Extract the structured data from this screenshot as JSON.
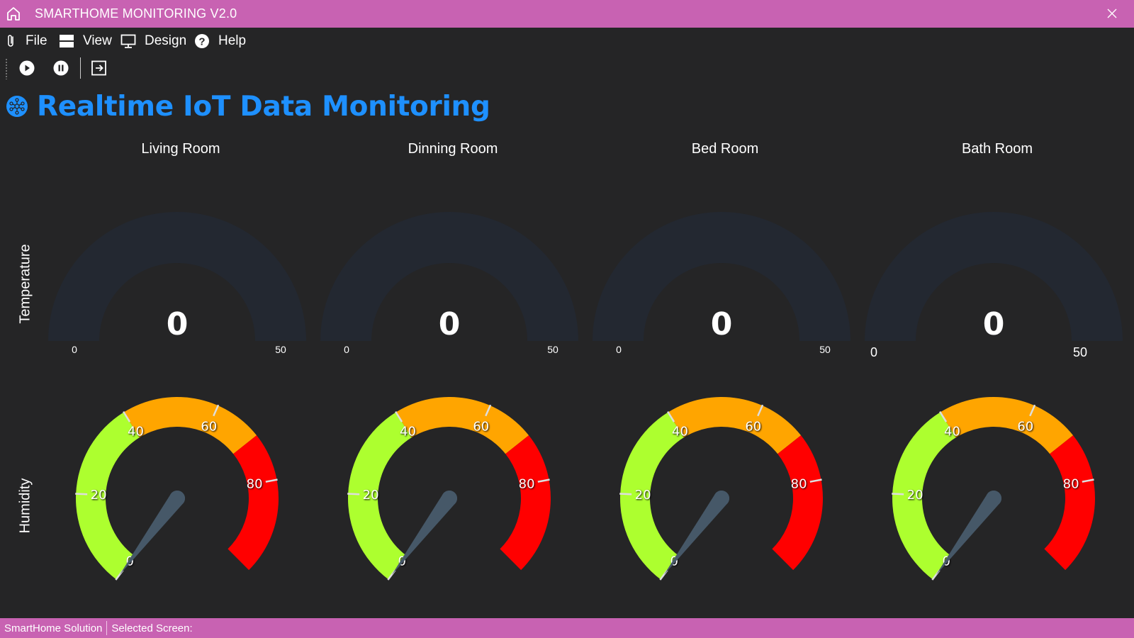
{
  "window": {
    "title": "SMARTHOME MONITORING V2.0",
    "icons": {
      "app": "home-icon",
      "close": "close-icon"
    }
  },
  "menu": {
    "items": [
      {
        "label": "File",
        "icon": "paperclip-icon"
      },
      {
        "label": "View",
        "icon": "view-icon"
      },
      {
        "label": "Design",
        "icon": "monitor-icon"
      },
      {
        "label": "Help",
        "icon": "help-icon"
      }
    ]
  },
  "toolbar": {
    "buttons": [
      {
        "icon": "play-icon"
      },
      {
        "icon": "pause-icon"
      },
      {
        "icon": "exit-icon"
      }
    ]
  },
  "page": {
    "heading": "Realtime IoT Data Monitoring",
    "heading_icon": "iot-network-icon",
    "heading_color": "#1e90ff"
  },
  "row_labels": {
    "temperature": "Temperature",
    "humidity": "Humidity"
  },
  "rooms": [
    {
      "name": "Living Room",
      "temperature": 0,
      "humidity": 0
    },
    {
      "name": "Dinning Room",
      "temperature": 0,
      "humidity": 0
    },
    {
      "name": "Bed Room",
      "temperature": 0,
      "humidity": 0
    },
    {
      "name": "Bath Room",
      "temperature": 0,
      "humidity": 0
    }
  ],
  "temperature_gauge": {
    "min": 0,
    "max": 50,
    "min_label": "0",
    "max_label": "50",
    "track_color": "#232831"
  },
  "humidity_gauge": {
    "min": 0,
    "max": 100,
    "tick_labels": [
      "0",
      "20",
      "40",
      "60",
      "80"
    ],
    "sections": [
      {
        "from": 0,
        "to": 40,
        "color": "#adff2f"
      },
      {
        "from": 40,
        "to": 70,
        "color": "#ffa500"
      },
      {
        "from": 70,
        "to": 100,
        "color": "#ff0000"
      }
    ],
    "needle_color": "#465868"
  },
  "status": {
    "solution": "SmartHome Solution",
    "selected_screen": "Selected Screen:"
  },
  "colors": {
    "titlebar": "#c862b2",
    "background": "#252526"
  }
}
